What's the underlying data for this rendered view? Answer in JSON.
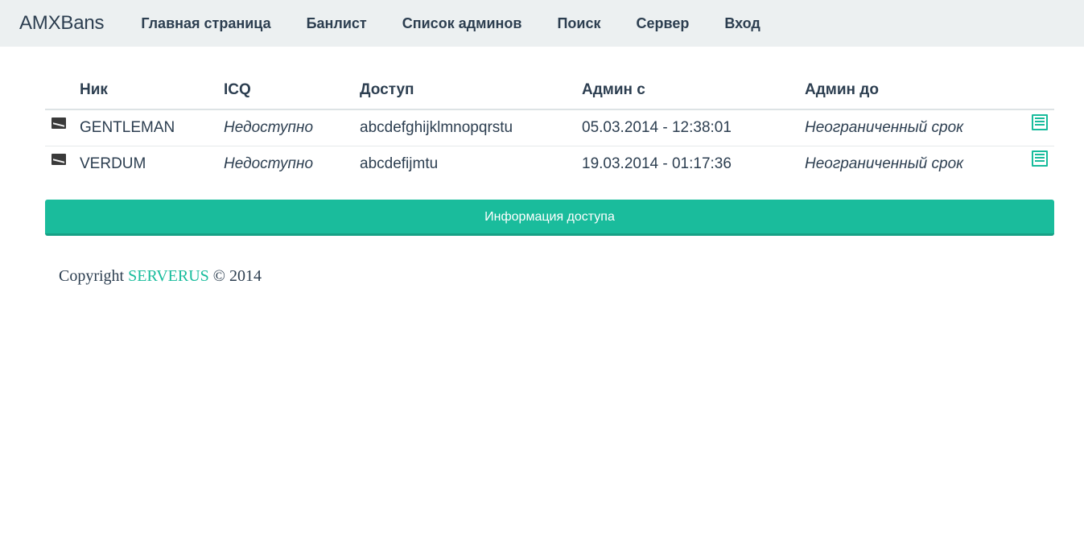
{
  "navbar": {
    "brand": "AMXBans",
    "items": [
      {
        "label": "Главная страница"
      },
      {
        "label": "Банлист"
      },
      {
        "label": "Список админов"
      },
      {
        "label": "Поиск"
      },
      {
        "label": "Сервер"
      },
      {
        "label": "Вход"
      }
    ]
  },
  "table": {
    "headers": {
      "nick": "Ник",
      "icq": "ICQ",
      "access": "Доступ",
      "admin_from": "Админ с",
      "admin_to": "Админ до"
    },
    "rows": [
      {
        "nick": "GENTLEMAN",
        "icq": "Недоступно",
        "access": "abcdefghijklmnopqrstu",
        "admin_from": "05.03.2014 - 12:38:01",
        "admin_to": "Неограниченный срок"
      },
      {
        "nick": "VERDUM",
        "icq": "Недоступно",
        "access": "abcdefijmtu",
        "admin_from": "19.03.2014 - 01:17:36",
        "admin_to": "Неограниченный срок"
      }
    ]
  },
  "access_info_button": "Информация доступа",
  "footer": {
    "prefix": "Copyright",
    "link": "SERVERUS",
    "suffix": "© 2014"
  },
  "icons": {
    "mail": "envelope-icon",
    "details": "list-icon"
  },
  "colors": {
    "accent": "#1abc9c",
    "navbar_bg": "#ecf0f1",
    "text": "#2c3e50"
  }
}
